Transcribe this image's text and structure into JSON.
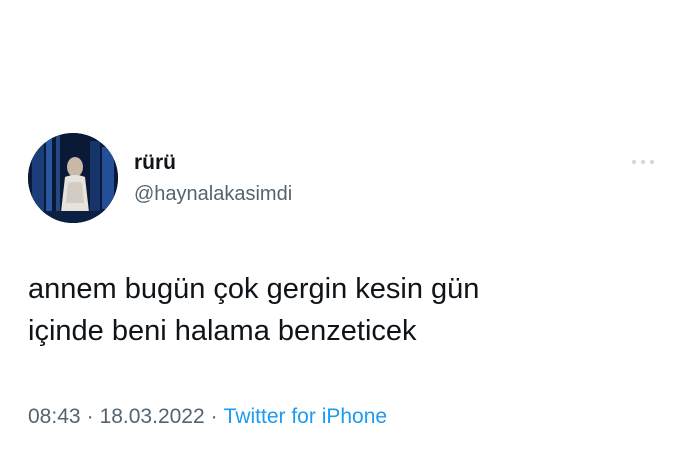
{
  "tweet": {
    "author": {
      "display_name": "rürü",
      "handle": "@haynalakasimdi"
    },
    "text": "annem bugün çok gergin kesin gün\niçinde beni halama benzeticek",
    "time": "08:43",
    "separator": "·",
    "date": "18.03.2022",
    "source": "Twitter for iPhone"
  },
  "icons": {
    "more": "more-horizontal-icon"
  },
  "colors": {
    "text_primary": "#0f1419",
    "text_secondary": "#536471",
    "link": "#1d9bf0",
    "more_icon": "#cfd9de"
  }
}
